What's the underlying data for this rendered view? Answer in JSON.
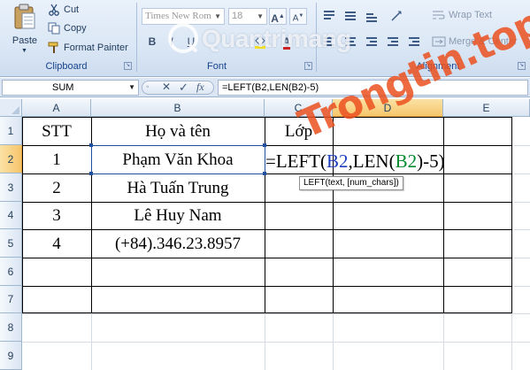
{
  "ribbon": {
    "clipboard": {
      "paste_label": "Paste",
      "cut_label": "Cut",
      "copy_label": "Copy",
      "format_painter_label": "Format Painter",
      "group_label": "Clipboard"
    },
    "font": {
      "font_name": "Times New Rom",
      "font_size": "18",
      "grow_label": "A",
      "shrink_label": "A",
      "bold_label": "B",
      "italic_label": "I",
      "underline_label": "U",
      "group_label": "Font"
    },
    "alignment": {
      "wrap_text_label": "Wrap Text",
      "merge_center_label": "Merge & Center",
      "group_label": "Alignment"
    }
  },
  "watermark": {
    "text": "Quantrimang",
    "diagonal_text": "Trongtin.top"
  },
  "formula_bar": {
    "name_box": "SUM",
    "cancel_symbol": "✕",
    "enter_symbol": "✓",
    "fx_label": "fx",
    "formula": "=LEFT(B2,LEN(B2)-5)"
  },
  "columns": [
    "A",
    "B",
    "C",
    "D",
    "E"
  ],
  "rows": [
    "1",
    "2",
    "3",
    "4",
    "5",
    "6",
    "7",
    "8",
    "9"
  ],
  "table": {
    "header": [
      "STT",
      "Họ và tên",
      "Lớp"
    ],
    "records": [
      {
        "stt": "1",
        "name": "Phạm Văn Khoa"
      },
      {
        "stt": "2",
        "name": "Hà Tuấn Trung"
      },
      {
        "stt": "3",
        "name": "Lê Huy Nam"
      },
      {
        "stt": "4",
        "name": "(+84).346.23.8957"
      }
    ]
  },
  "editing": {
    "prefix": "=LEFT(",
    "ref1": "B2",
    "middle": ",LEN(",
    "ref2": "B2",
    "suffix": ")-5)",
    "tooltip": "LEFT(text, [num_chars])"
  },
  "colors": {
    "active_header": "#f6c56b",
    "ref1_color": "#1f3fbf",
    "ref2_color": "#008a2e",
    "watermark_orange": "#eb501e"
  }
}
